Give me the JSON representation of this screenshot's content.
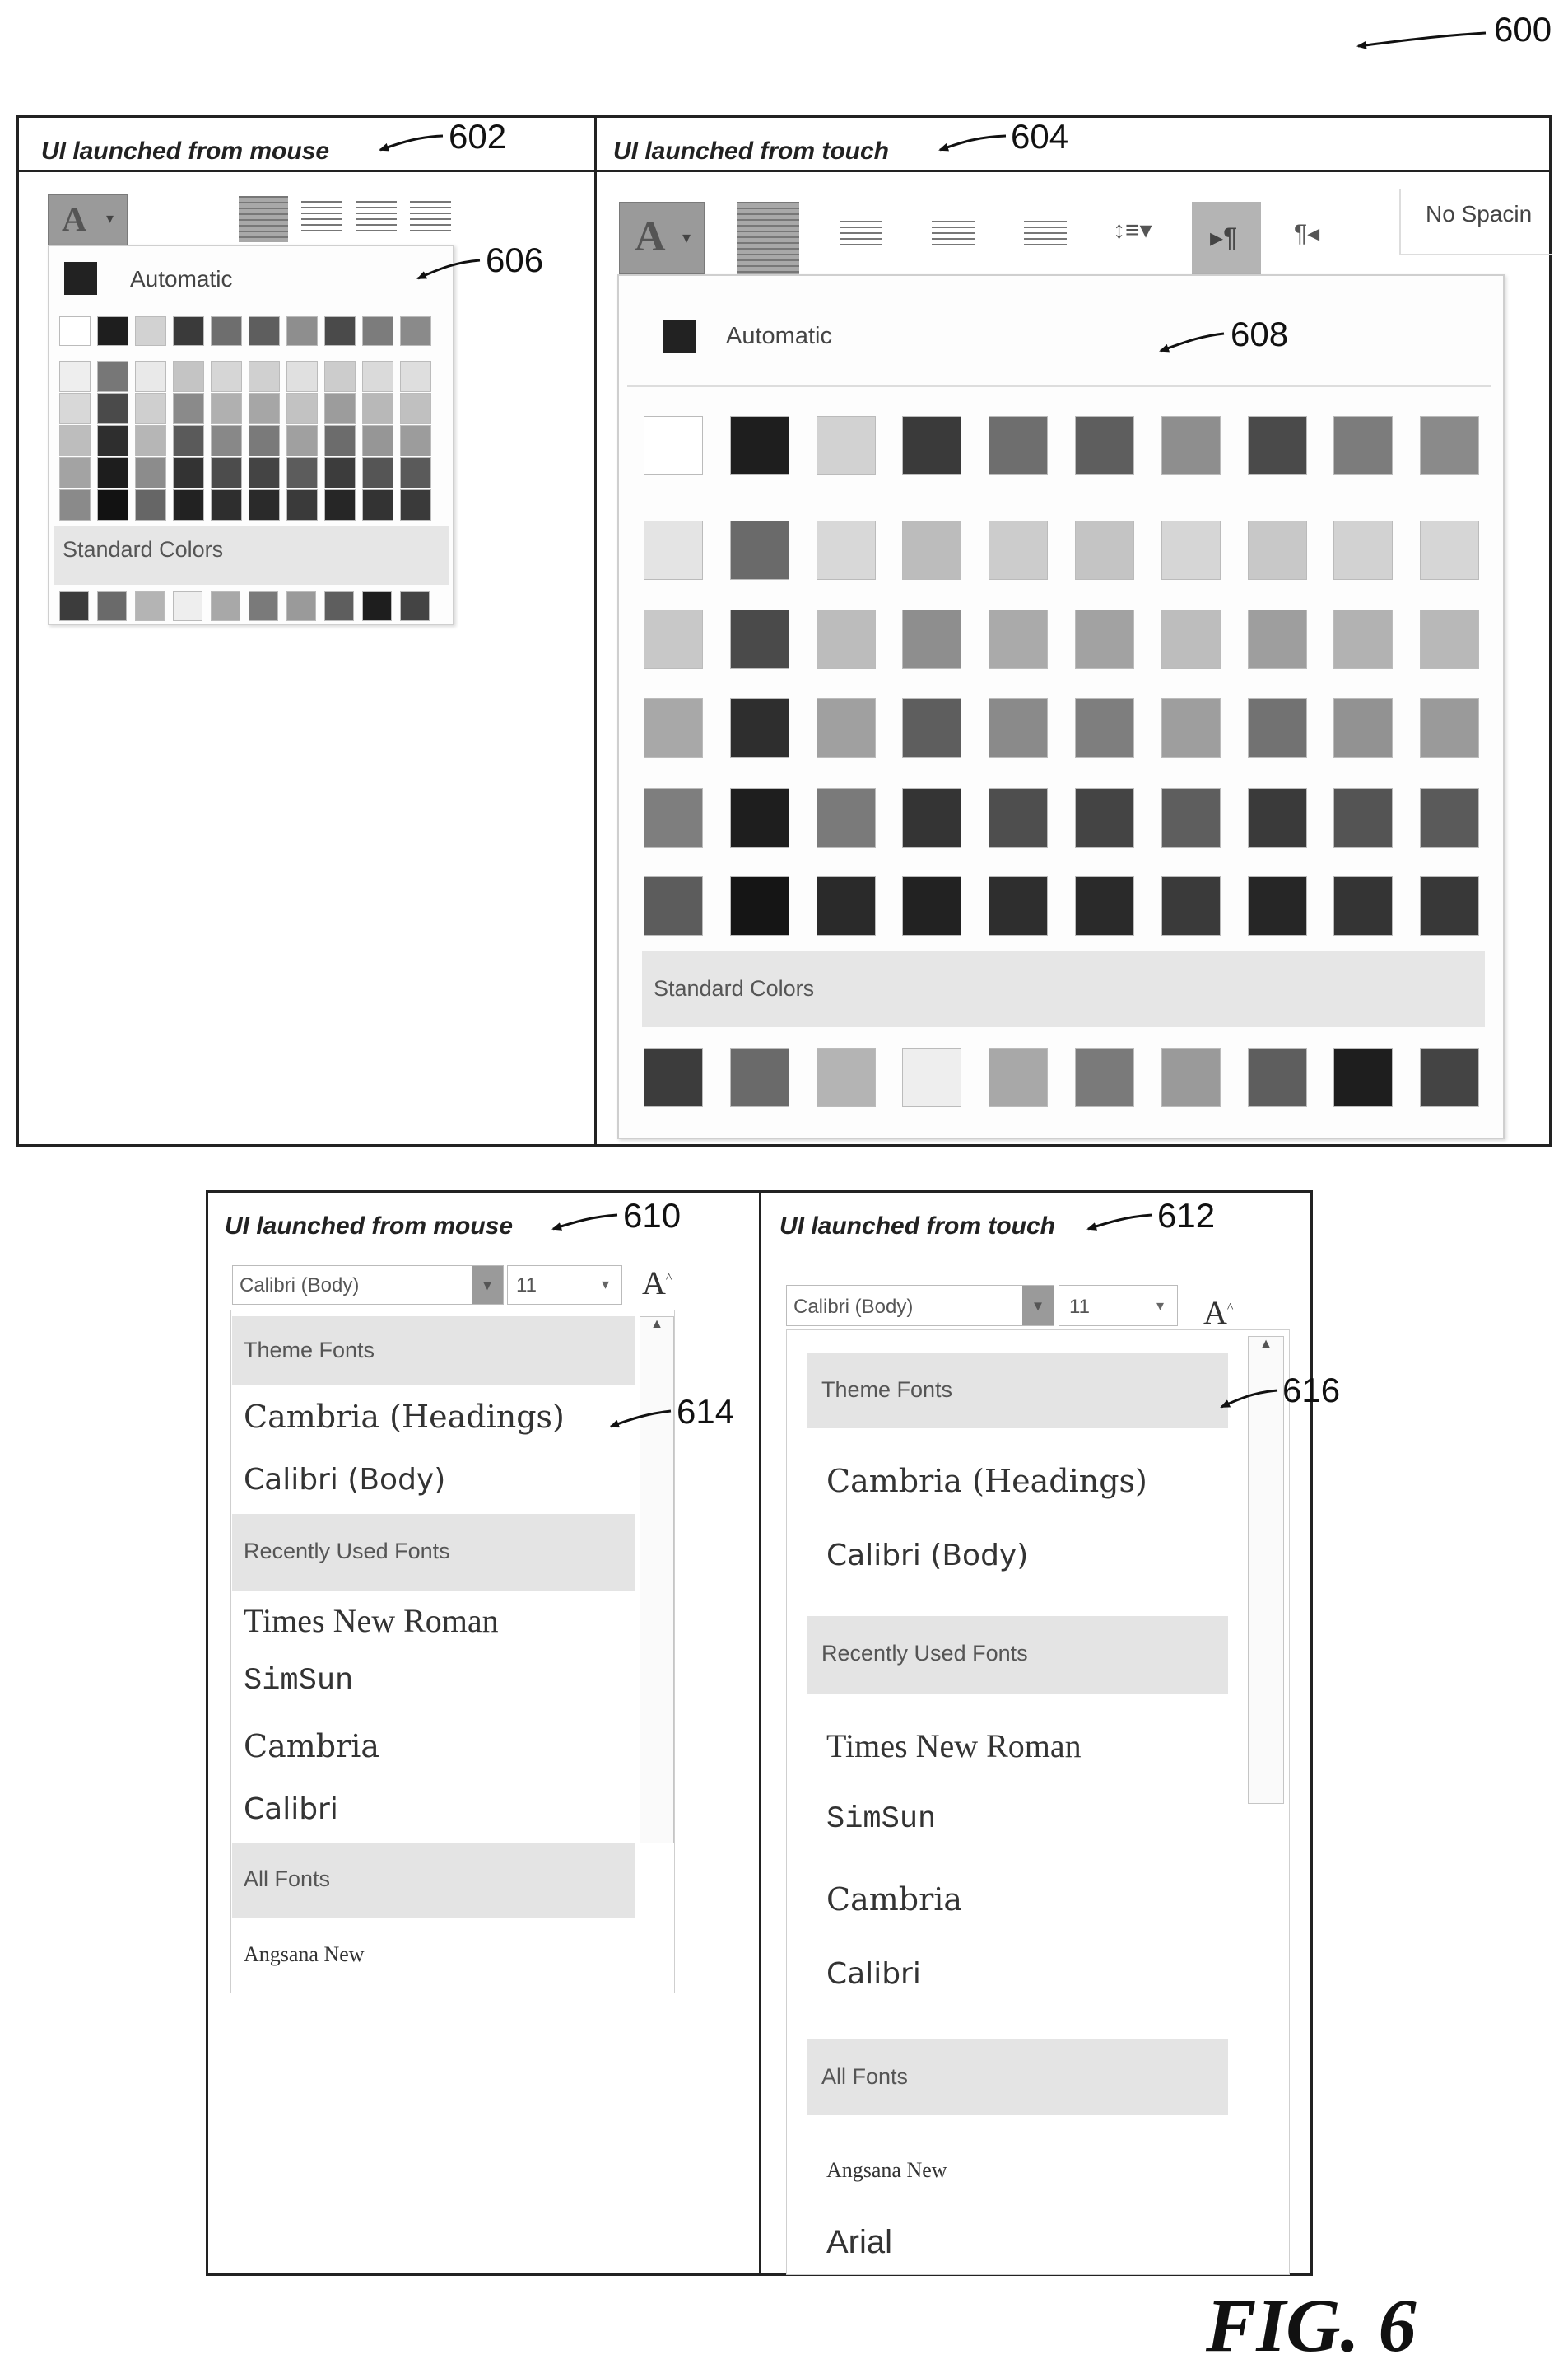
{
  "figure": {
    "ref": "600",
    "caption": "FIG. 6"
  },
  "top": {
    "mouse": {
      "label": "UI launched from mouse",
      "ref": "602",
      "panel_ref": "606",
      "font_color_glyph": "A",
      "automatic_label": "Automatic",
      "standard_colors_label": "Standard Colors",
      "theme_top_row": [
        "#ffffff",
        "#1e1e1e",
        "#d2d2d2",
        "#3a3a3a",
        "#6e6e6e",
        "#5e5e5e",
        "#8e8e8e",
        "#4a4a4a",
        "#7c7c7c",
        "#8a8a8a"
      ],
      "theme_columns_shades": [
        [
          "#eeeeee",
          "#d8d8d8",
          "#bdbdbd",
          "#a3a3a3",
          "#8a8a8a"
        ],
        [
          "#777777",
          "#4a4a4a",
          "#2e2e2e",
          "#1d1d1d",
          "#121212"
        ],
        [
          "#e9e9e9",
          "#cfcfcf",
          "#b6b6b6",
          "#8c8c8c",
          "#666666"
        ],
        [
          "#c4c4c4",
          "#8a8a8a",
          "#5a5a5a",
          "#333333",
          "#222222"
        ],
        [
          "#d6d6d6",
          "#b0b0b0",
          "#888888",
          "#4c4c4c",
          "#2e2e2e"
        ],
        [
          "#d0d0d0",
          "#a6a6a6",
          "#7a7a7a",
          "#444444",
          "#2a2a2a"
        ],
        [
          "#e0e0e0",
          "#c2c2c2",
          "#a0a0a0",
          "#5c5c5c",
          "#3a3a3a"
        ],
        [
          "#cccccc",
          "#9c9c9c",
          "#6c6c6c",
          "#3c3c3c",
          "#262626"
        ],
        [
          "#dadada",
          "#b8b8b8",
          "#969696",
          "#555555",
          "#333333"
        ],
        [
          "#dedede",
          "#c0c0c0",
          "#9c9c9c",
          "#5a5a5a",
          "#3a3a3a"
        ]
      ],
      "standard_colors": [
        "#3c3c3c",
        "#6a6a6a",
        "#b4b4b4",
        "#eeeeee",
        "#a8a8a8",
        "#7a7a7a",
        "#9a9a9a",
        "#5e5e5e",
        "#1e1e1e",
        "#444444"
      ]
    },
    "touch": {
      "label": "UI launched from touch",
      "ref": "604",
      "panel_ref": "608",
      "font_color_glyph": "A",
      "style_label": "No Spacin",
      "automatic_label": "Automatic",
      "standard_colors_label": "Standard Colors",
      "theme_rows": [
        [
          "#ffffff",
          "#1e1e1e",
          "#d2d2d2",
          "#3a3a3a",
          "#6e6e6e",
          "#5e5e5e",
          "#8e8e8e",
          "#4a4a4a",
          "#7c7c7c",
          "#8a8a8a"
        ],
        [
          "#e4e4e4",
          "#6a6a6a",
          "#d8d8d8",
          "#bcbcbc",
          "#cccccc",
          "#c4c4c4",
          "#d6d6d6",
          "#c8c8c8",
          "#d2d2d2",
          "#d6d6d6"
        ],
        [
          "#c8c8c8",
          "#4a4a4a",
          "#bcbcbc",
          "#8e8e8e",
          "#aaaaaa",
          "#a2a2a2",
          "#bdbdbd",
          "#9e9e9e",
          "#b2b2b2",
          "#b8b8b8"
        ],
        [
          "#a8a8a8",
          "#2e2e2e",
          "#a0a0a0",
          "#5e5e5e",
          "#8a8a8a",
          "#7e7e7e",
          "#9e9e9e",
          "#727272",
          "#929292",
          "#9a9a9a"
        ],
        [
          "#7e7e7e",
          "#1e1e1e",
          "#7a7a7a",
          "#343434",
          "#4e4e4e",
          "#444444",
          "#5e5e5e",
          "#3a3a3a",
          "#545454",
          "#5a5a5a"
        ],
        [
          "#5c5c5c",
          "#151515",
          "#2a2a2a",
          "#222222",
          "#2e2e2e",
          "#2a2a2a",
          "#3a3a3a",
          "#262626",
          "#343434",
          "#383838"
        ]
      ],
      "standard_colors": [
        "#3c3c3c",
        "#6a6a6a",
        "#b4b4b4",
        "#eeeeee",
        "#a8a8a8",
        "#7a7a7a",
        "#9a9a9a",
        "#5e5e5e",
        "#1e1e1e",
        "#444444"
      ]
    }
  },
  "bottom": {
    "mouse": {
      "label": "UI launched from mouse",
      "ref": "610",
      "list_ref": "614",
      "font_box": "Calibri (Body)",
      "size_box": "11",
      "theme_fonts_header": "Theme Fonts",
      "theme_fonts": [
        "Cambria (Headings)",
        "Calibri (Body)"
      ],
      "recent_header": "Recently Used Fonts",
      "recent_fonts": [
        "Times New Roman",
        "SimSun",
        "Cambria",
        "Calibri"
      ],
      "all_header": "All Fonts",
      "all_fonts": [
        "Angsana New"
      ]
    },
    "touch": {
      "label": "UI launched from touch",
      "ref": "612",
      "list_ref": "616",
      "font_box": "Calibri (Body)",
      "size_box": "11",
      "theme_fonts_header": "Theme Fonts",
      "theme_fonts": [
        "Cambria (Headings)",
        "Calibri (Body)"
      ],
      "recent_header": "Recently Used Fonts",
      "recent_fonts": [
        "Times New Roman",
        "SimSun",
        "Cambria",
        "Calibri"
      ],
      "all_header": "All Fonts",
      "all_fonts": [
        "Angsana New",
        "Arial"
      ]
    }
  }
}
